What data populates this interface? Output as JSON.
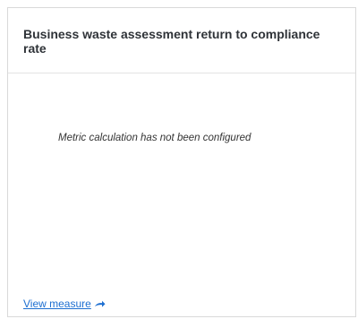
{
  "card": {
    "title": "Business waste assessment return to compliance rate",
    "message": "Metric calculation has not been configured",
    "link_label": "View measure",
    "link_icon": "arrow-right-icon",
    "accent_color": "#1d6fd1",
    "border_color": "#d9d9d9"
  }
}
